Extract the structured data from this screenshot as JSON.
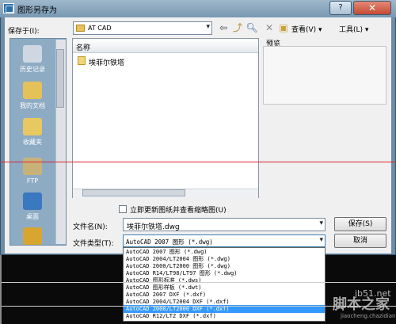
{
  "window": {
    "title": "图形另存为",
    "help": "?",
    "close": "✕"
  },
  "toolbar": {
    "save_in_label": "保存于(I):",
    "current_folder": "AT CAD",
    "view_label": "查看(V) ▾",
    "tools_label": "工具(L) ▾"
  },
  "places": [
    {
      "label": "历史记录",
      "icon": "history-icon"
    },
    {
      "label": "我的文档",
      "icon": "documents-icon"
    },
    {
      "label": "收藏夹",
      "icon": "favorites-icon"
    },
    {
      "label": "FTP",
      "icon": "ftp-icon"
    },
    {
      "label": "桌面",
      "icon": "desktop-icon"
    }
  ],
  "file_list": {
    "column_name": "名称",
    "files": [
      {
        "name": "埃菲尔铁塔"
      }
    ]
  },
  "preview_label": "预览",
  "update_thumbnail_label": "立即更新图纸并查看缩略图(U)",
  "filename": {
    "label": "文件名(N):",
    "value": "埃菲尔铁塔.dwg"
  },
  "filetype": {
    "label": "文件类型(T):",
    "value": "AutoCAD 2007 图形 (*.dwg)",
    "options": [
      "AutoCAD 2007 图形 (*.dwg)",
      "AutoCAD 2004/LT2004 图形 (*.dwg)",
      "AutoCAD 2000/LT2000 图形 (*.dwg)",
      "AutoCAD R14/LT98/LT97 图形 (*.dwg)",
      "AutoCAD 图形标准 (*.dws)",
      "AutoCAD 图形样板 (*.dwt)",
      "AutoCAD 2007 DXF (*.dxf)",
      "AutoCAD 2004/LT2004 DXF (*.dxf)",
      "AutoCAD 2000/LT2000 DXF (*.dxf)",
      "AutoCAD R12/LT2 DXF (*.dxf)"
    ],
    "selected_index": 8
  },
  "buttons": {
    "save": "保存(S)",
    "cancel": "取消"
  },
  "watermark": {
    "url": "jb51.net",
    "text": "脚本之家",
    "sub": "jiaocheng.chazidian.com"
  },
  "colors": {
    "selection": "#3399ff",
    "accent": "#d8262c"
  }
}
